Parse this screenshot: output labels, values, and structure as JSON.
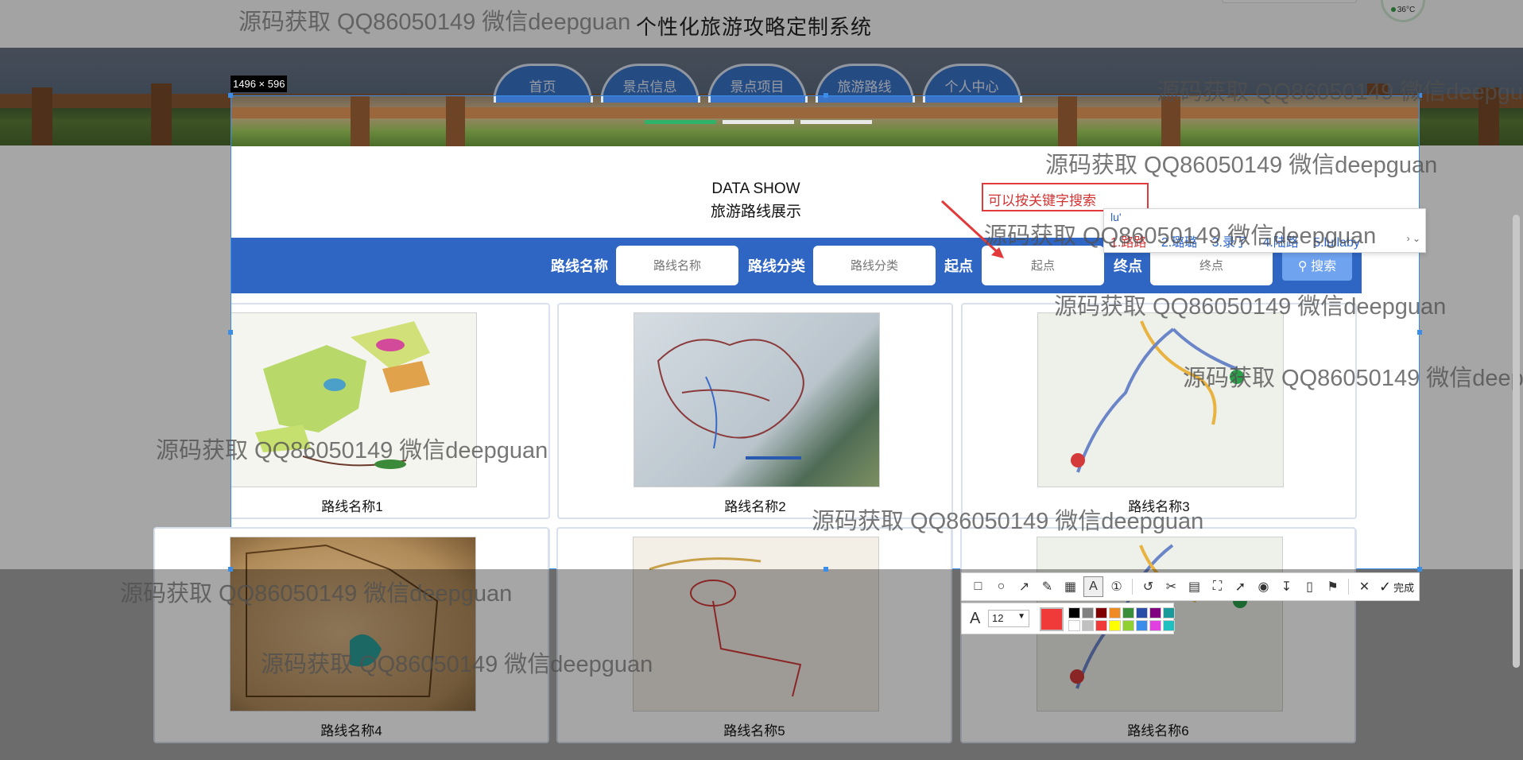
{
  "site": {
    "title": "个性化旅游攻略定制系统",
    "weather": "36°C",
    "nav": [
      "首页",
      "景点信息",
      "景点项目",
      "旅游路线",
      "个人中心"
    ]
  },
  "section": {
    "en_title": "DATA SHOW",
    "zh_title": "旅游路线展示"
  },
  "search": {
    "route_name_label": "路线名称",
    "route_name_placeholder": "路线名称",
    "category_label": "路线分类",
    "category_placeholder": "路线分类",
    "start_label": "起点",
    "start_placeholder": "起点",
    "end_label": "终点",
    "end_placeholder": "终点",
    "button": "搜索"
  },
  "annotation": {
    "text": "可以按关键字搜索"
  },
  "ime": {
    "composition": "lu'",
    "candidates": [
      "1.路路",
      "2.璐璐",
      "3.录了",
      "4.陆路",
      "5.lullaby"
    ]
  },
  "cards": [
    {
      "name": "路线名称1"
    },
    {
      "name": "路线名称2"
    },
    {
      "name": "路线名称3"
    },
    {
      "name": "路线名称4"
    },
    {
      "name": "路线名称5"
    },
    {
      "name": "路线名称6"
    }
  ],
  "capture_tool": {
    "size_label": "1496 × 596",
    "done_label": "完成",
    "font_size": "12",
    "active_color": "#f03a3a",
    "palette": [
      "#000000",
      "#808080",
      "#800000",
      "#f08a24",
      "#3a8e3a",
      "#2a4ea8",
      "#800080",
      "#1a9a9a",
      "#ffffff",
      "#c0c0c0",
      "#f03a3a",
      "#ffff00",
      "#90d030",
      "#3a8eea",
      "#e040e0",
      "#20c0c0"
    ],
    "tools": [
      "rectangle-icon",
      "ellipse-icon",
      "arrow-icon",
      "pen-icon",
      "mosaic-icon",
      "text-icon",
      "number-icon",
      "undo-icon",
      "scissors-icon",
      "ocr-icon",
      "scan-icon",
      "pin-icon",
      "record-icon",
      "download-icon",
      "save-icon",
      "bookmark-icon",
      "close-icon",
      "check-icon"
    ]
  },
  "watermark": "源码获取 QQ86050149 微信deepguan"
}
